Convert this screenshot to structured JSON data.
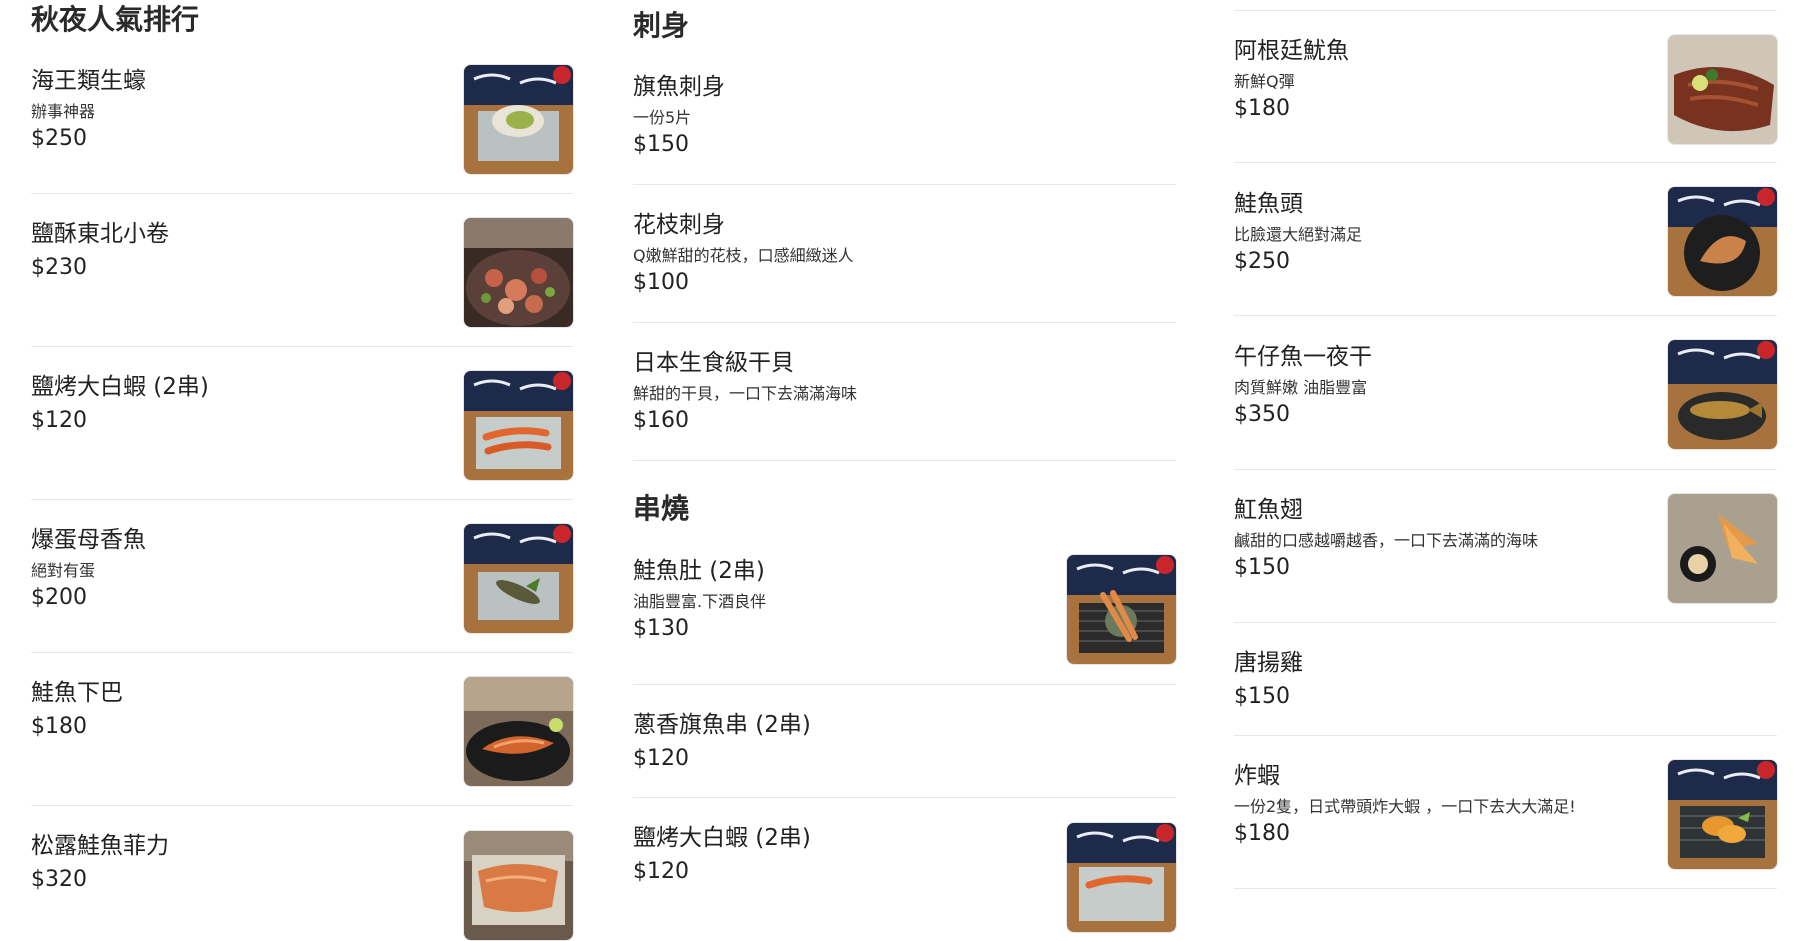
{
  "column1": {
    "title": "秋夜人氣排行",
    "items": [
      {
        "name": "海王類生蠔",
        "desc": "辦事神器",
        "price": "$250",
        "photo_icon": "oyster-photo"
      },
      {
        "name": "鹽酥東北小卷",
        "desc": "",
        "price": "$230",
        "photo_icon": "fried-squid-photo"
      },
      {
        "name": "鹽烤大白蝦 (2串)",
        "desc": "",
        "price": "$120",
        "photo_icon": "grilled-shrimp-photo"
      },
      {
        "name": "爆蛋母香魚",
        "desc": "絕對有蛋",
        "price": "$200",
        "photo_icon": "sweetfish-photo"
      },
      {
        "name": "鮭魚下巴",
        "desc": "",
        "price": "$180",
        "photo_icon": "salmon-collar-photo"
      },
      {
        "name": "松露鮭魚菲力",
        "desc": "",
        "price": "$320",
        "photo_icon": "salmon-fillet-photo"
      }
    ]
  },
  "column2": {
    "sections": [
      {
        "title": "刺身",
        "items": [
          {
            "name": "旗魚刺身",
            "desc": "一份5片",
            "price": "$150"
          },
          {
            "name": "花枝刺身",
            "desc": "Q嫩鮮甜的花枝，口感細緻迷人",
            "price": "$100"
          },
          {
            "name": "日本生食級干貝",
            "desc": "鮮甜的干貝，一口下去滿滿海味",
            "price": "$160"
          }
        ]
      },
      {
        "title": "串燒",
        "items": [
          {
            "name": "鮭魚肚 (2串)",
            "desc": "油脂豐富.下酒良伴",
            "price": "$130",
            "photo_icon": "salmon-belly-skewer-photo"
          },
          {
            "name": "蔥香旗魚串 (2串)",
            "desc": "",
            "price": "$120"
          },
          {
            "name": "鹽烤大白蝦 (2串)",
            "desc": "",
            "price": "$120",
            "photo_icon": "grilled-shrimp-photo"
          }
        ]
      }
    ]
  },
  "column3": {
    "items": [
      {
        "name": "阿根廷魷魚",
        "desc": "新鮮Q彈",
        "price": "$180",
        "photo_icon": "argentine-squid-photo"
      },
      {
        "name": "鮭魚頭",
        "desc": "比臉還大絕對滿足",
        "price": "$250",
        "photo_icon": "salmon-head-photo"
      },
      {
        "name": "午仔魚一夜干",
        "desc": "肉質鮮嫩 油脂豐富",
        "price": "$350",
        "photo_icon": "threadfin-fish-photo"
      },
      {
        "name": "魟魚翅",
        "desc": "鹹甜的口感越嚼越香，一口下去滿滿的海味",
        "price": "$150",
        "photo_icon": "stingray-fin-photo"
      },
      {
        "name": "唐揚雞",
        "desc": "",
        "price": "$150"
      },
      {
        "name": "炸蝦",
        "desc": "一份2隻，日式帶頭炸大蝦 ，一口下去大大滿足!",
        "price": "$180",
        "photo_icon": "fried-shrimp-photo"
      }
    ]
  },
  "colors": {
    "text": "#222222",
    "divider": "#e7e7e7",
    "curtain": "#1d2a4a",
    "wood": "#a8723f",
    "plate": "#c5ccc9"
  }
}
